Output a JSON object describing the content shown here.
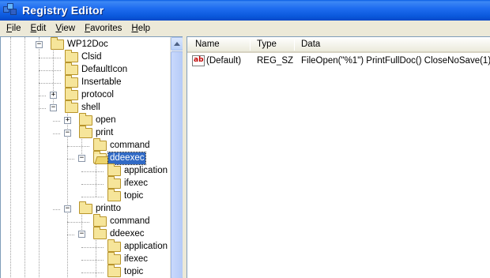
{
  "window": {
    "title": "Registry Editor",
    "title_color": "#ffffff",
    "titlebar_color": "#0a58db"
  },
  "menu": [
    {
      "accel": "F",
      "rest": "ile"
    },
    {
      "accel": "E",
      "rest": "dit"
    },
    {
      "accel": "V",
      "rest": "iew"
    },
    {
      "accel": "F",
      "rest": "avorites"
    },
    {
      "accel": "H",
      "rest": "elp"
    }
  ],
  "tree": {
    "nodes": [
      {
        "label": "WP12Doc",
        "expander": "−",
        "selected": false,
        "open": false
      },
      {
        "label": "Clsid",
        "expander": "",
        "selected": false,
        "open": false
      },
      {
        "label": "DefaultIcon",
        "expander": "",
        "selected": false,
        "open": false
      },
      {
        "label": "Insertable",
        "expander": "",
        "selected": false,
        "open": false
      },
      {
        "label": "protocol",
        "expander": "+",
        "selected": false,
        "open": false
      },
      {
        "label": "shell",
        "expander": "−",
        "selected": false,
        "open": false
      },
      {
        "label": "open",
        "expander": "+",
        "selected": false,
        "open": false
      },
      {
        "label": "print",
        "expander": "−",
        "selected": false,
        "open": false
      },
      {
        "label": "command",
        "expander": "",
        "selected": false,
        "open": false
      },
      {
        "label": "ddeexec",
        "expander": "−",
        "selected": true,
        "open": true
      },
      {
        "label": "application",
        "expander": "",
        "selected": false,
        "open": false
      },
      {
        "label": "ifexec",
        "expander": "",
        "selected": false,
        "open": false
      },
      {
        "label": "topic",
        "expander": "",
        "selected": false,
        "open": false
      },
      {
        "label": "printto",
        "expander": "−",
        "selected": false,
        "open": false
      },
      {
        "label": "command",
        "expander": "",
        "selected": false,
        "open": false
      },
      {
        "label": "ddeexec",
        "expander": "−",
        "selected": false,
        "open": false
      },
      {
        "label": "application",
        "expander": "",
        "selected": false,
        "open": false
      },
      {
        "label": "ifexec",
        "expander": "",
        "selected": false,
        "open": false
      },
      {
        "label": "topic",
        "expander": "",
        "selected": false,
        "open": false
      }
    ],
    "selection_color": "#316ac5"
  },
  "list": {
    "columns": [
      "Name",
      "Type",
      "Data"
    ],
    "rows": [
      {
        "icon": "string-value-icon",
        "icon_text": "ab",
        "name": "(Default)",
        "type": "REG_SZ",
        "data": "FileOpen(\"%1\") PrintFullDoc() CloseNoSave(1)"
      }
    ]
  }
}
